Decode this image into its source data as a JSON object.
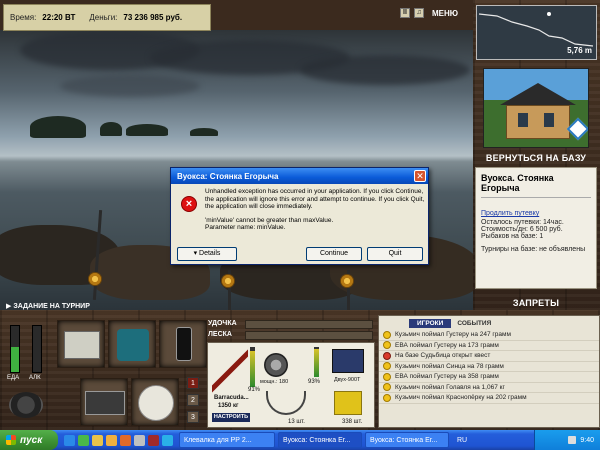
{
  "topbar": {
    "time_label": "Время:",
    "time_value": "22:20 ВТ",
    "money_label": "Деньги:",
    "money_value": "73 236 985 руб."
  },
  "menu": {
    "pause_glyph": "II",
    "sound_glyph": "♫",
    "label": "МЕНЮ"
  },
  "minimap": {
    "depth": "5,76 m"
  },
  "right": {
    "back_button": "ВЕРНУТЬСЯ НА БАЗУ",
    "location_title": "Вуокса. Стоянка Егорыча",
    "extend_link": "Продлить путевку",
    "lines": [
      "Осталось путевки: 14час.",
      "Стоимость/дн: 6 500 руб.",
      "Рыбаков на базе: 1"
    ],
    "tournaments": "Турниры на базе: не объявлены",
    "bans_button": "ЗАПРЕТЫ"
  },
  "scene": {
    "tournament_task": "ЗАДАНИЕ НА ТУРНИР"
  },
  "bottom": {
    "food_label": "ЕДА",
    "alc_label": "АЛК",
    "slot_numbers": [
      "1",
      "2",
      "3"
    ],
    "rod_label": "УДОЧКА",
    "line_label": "ЛЕСКА",
    "rod_name": "Barracuda...",
    "rod_weight": "1350 кг",
    "rod_pct": "91%",
    "reel_info": "мощн.: 180",
    "reel_pct": "93%",
    "line_info": "Двух-900Т",
    "hooks_count": "13 шт.",
    "bait_count": "338 шт.",
    "setup_button": "НАСТРОИТЬ"
  },
  "events": {
    "tab_players": "ИГРОКИ",
    "tab_events": "СОБЫТИЯ",
    "rows": [
      "Кузьмич поймал Густеру на 247 грамм",
      "ЕВА поймал Густеру на 173 грамм",
      "На базе Судьбица открыт квест",
      "Кузьмич поймал Синца на 78 грамм",
      "ЕВА поймал Густеру на 358 грамм",
      "Кузьмич поймал Голавля на 1,067 кг",
      "Кузьмич поймал Краснопёрку на 202 грамм"
    ]
  },
  "dialog": {
    "title": "Вуокса: Стоянка Егорыча",
    "close": "✕",
    "message_1": "Unhandled exception has occurred in your application. If you click Continue, the application will ignore this error and attempt to continue. If you click Quit, the application will close immediately.",
    "message_2": "'minValue' cannot be greater than maxValue.",
    "message_3": "Parameter name: minValue.",
    "details_button": "Details",
    "continue_button": "Continue",
    "quit_button": "Quit"
  },
  "taskbar": {
    "start": "пуск",
    "tasks": [
      "Клевалка для РР 2...",
      "Вуокса: Стоянка Ег...",
      "Вуокса: Стоянка Ег..."
    ],
    "lang": "RU",
    "clock": "9:40"
  }
}
